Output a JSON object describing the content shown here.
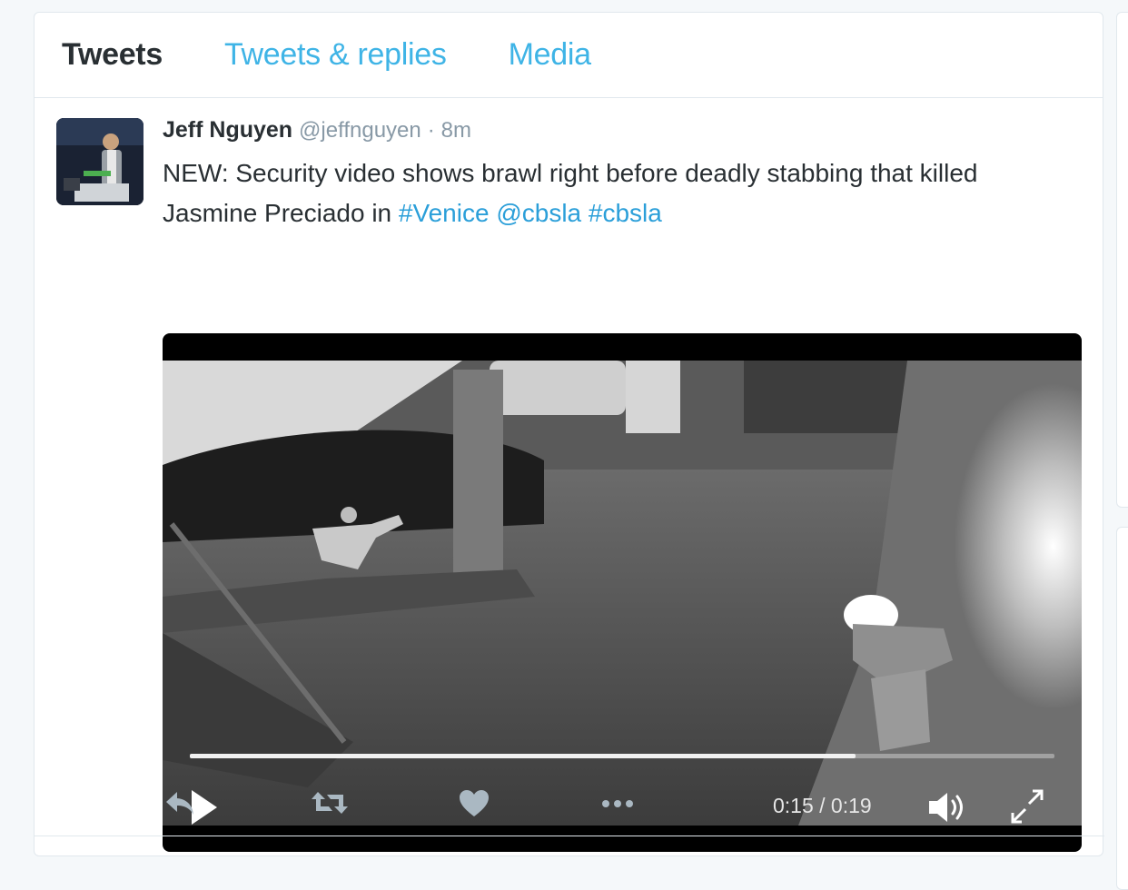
{
  "tabs": [
    {
      "label": "Tweets",
      "active": true
    },
    {
      "label": "Tweets & replies",
      "active": false
    },
    {
      "label": "Media",
      "active": false
    }
  ],
  "tweet": {
    "name": "Jeff Nguyen",
    "handle": "@jeffnguyen",
    "separator": "·",
    "time": "8m",
    "text_plain": "NEW: Security video shows brawl right before deadly stabbing that killed Jasmine Preciado in ",
    "links": [
      "#Venice",
      "@cbsla",
      "#cbsla"
    ]
  },
  "video": {
    "time_label": "0:15 / 0:19",
    "progress": 0.77
  },
  "actions": {
    "icons": [
      "reply-icon",
      "retweet-icon",
      "like-icon",
      "more-icon"
    ]
  },
  "colors": {
    "accent": "#1da1f2",
    "text": "#292f33",
    "muted": "#8899a6",
    "border": "#e1e8ed"
  }
}
